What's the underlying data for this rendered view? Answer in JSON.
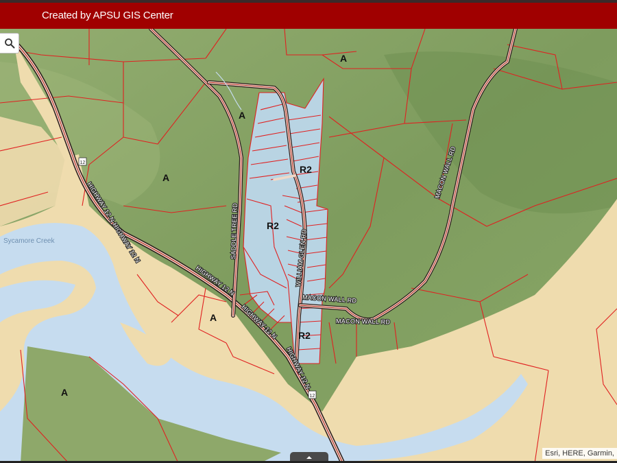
{
  "header": {
    "title": "Created by APSU GIS Center"
  },
  "map": {
    "water_label": "Sycamore Creek",
    "zones": [
      "A",
      "A",
      "A",
      "A",
      "A",
      "R2",
      "R2",
      "R2"
    ],
    "roads": {
      "saddle_tree": "SADDLE TREE RD",
      "william_glen": "WILLIAM GLEN RD",
      "macon_wall_1": "MACON WALL RD",
      "macon_wall_2": "MACON WALL RD",
      "highway_1": "HIGHWAY 12 N HIGHWAY 12 N",
      "highway_2": "HIGHWAY 12 N",
      "highway_3": "HIGHWAY 12 N",
      "highway_4": "HIGHWAY 12 N",
      "east_road": "MACON WALL RD"
    },
    "shields": [
      "12",
      "12"
    ]
  },
  "controls": {
    "attribution": "Esri, HERE, Garmin,"
  },
  "colors": {
    "header": "#a00000",
    "terrain": "#8ea86a",
    "floodplain": "#efdcae",
    "water": "#c6dcef",
    "r2_zone": "#bcd7ea",
    "parcel_line": "#e02020"
  },
  "icons": {
    "search": "search-icon",
    "expand": "chevron-up-icon"
  }
}
